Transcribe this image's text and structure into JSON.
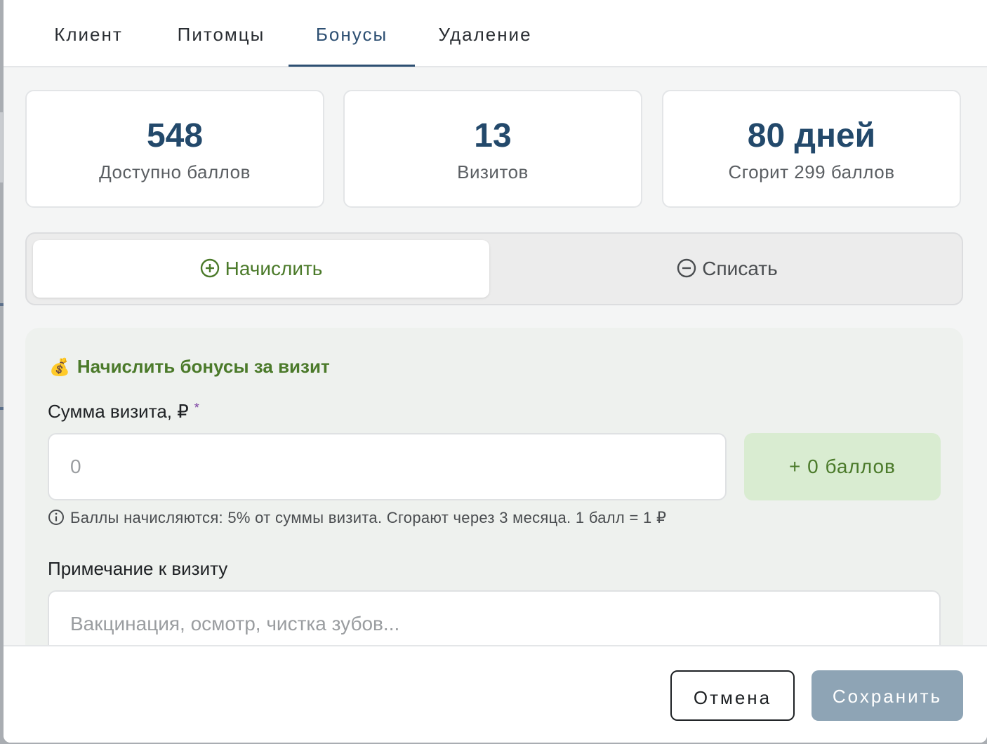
{
  "tabs": [
    {
      "label": "Клиент"
    },
    {
      "label": "Питомцы"
    },
    {
      "label": "Бонусы"
    },
    {
      "label": "Удаление"
    }
  ],
  "stats": [
    {
      "value": "548",
      "label": "Доступно баллов"
    },
    {
      "value": "13",
      "label": "Визитов"
    },
    {
      "value": "80 дней",
      "label": "Сгорит 299 баллов"
    }
  ],
  "mode": {
    "accrue_label": "Начислить",
    "spend_label": "Списать"
  },
  "panel": {
    "bag_icon": "💰",
    "title": "Начислить бонусы за визит",
    "amount_label": "Сумма визита, ₽",
    "required_mark": "*",
    "amount_placeholder": "0",
    "points_preview": "+ 0 баллов",
    "hint": "Баллы начисляются: 5% от суммы визита. Сгорают через 3 месяца. 1 балл = 1 ₽",
    "note_label": "Примечание к визиту",
    "note_placeholder": "Вакцинация, осмотр, чистка зубов..."
  },
  "footer": {
    "cancel_label": "Отмена",
    "save_label": "Сохранить"
  },
  "colors": {
    "accent_blue": "#23496b",
    "accent_green": "#4b7a2a",
    "save_button": "#8ea4b5"
  }
}
